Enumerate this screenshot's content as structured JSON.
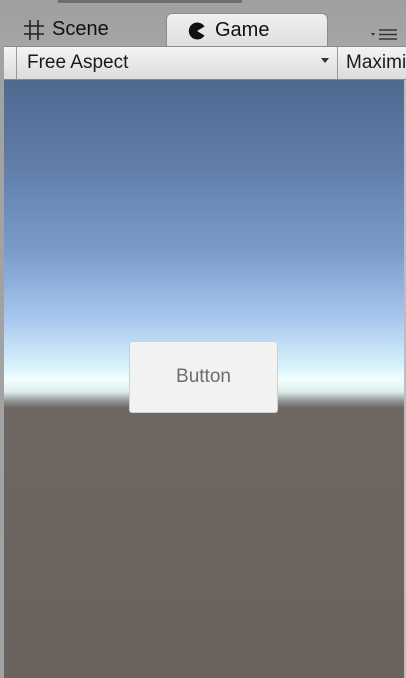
{
  "tabs": [
    {
      "label": "Scene",
      "icon": "grid-icon",
      "active": false
    },
    {
      "label": "Game",
      "icon": "pacman-icon",
      "active": true
    }
  ],
  "toolbar": {
    "aspect_label": "Free Aspect",
    "maximize_label": "Maximize On Play"
  },
  "game_view": {
    "button_label": "Button"
  },
  "colors": {
    "sky_top": "#4f6990",
    "horizon": "#f3ffff",
    "ground": "#6a625d",
    "button_bg": "#f2f2f2",
    "button_text": "#6d6d6d"
  }
}
